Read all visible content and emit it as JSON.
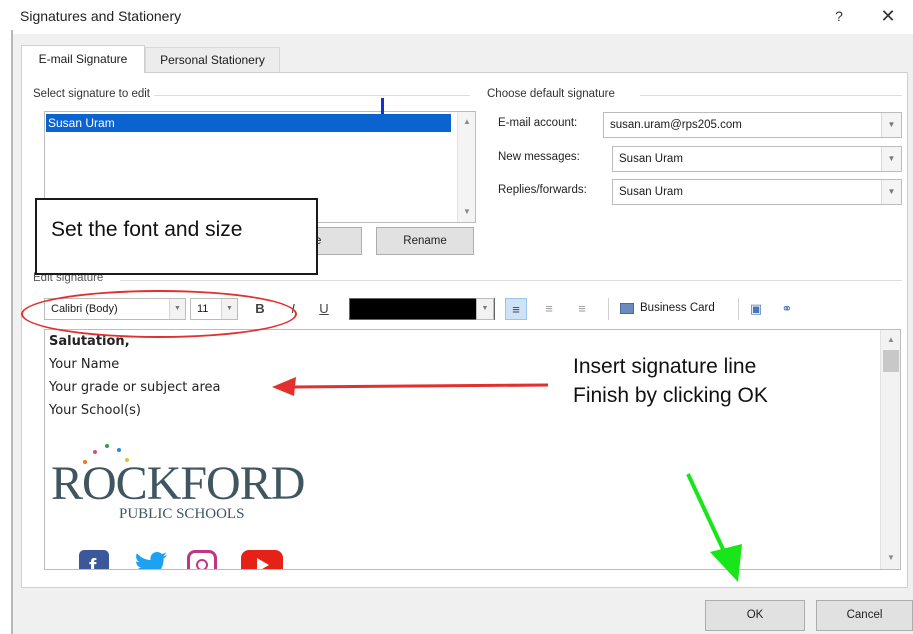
{
  "window": {
    "title": "Signatures and Stationery",
    "help_glyph": "?",
    "close_glyph": "✕"
  },
  "tabs": [
    {
      "label": "E-mail Signature",
      "active": true
    },
    {
      "label": "Personal Stationery",
      "active": false
    }
  ],
  "select_signature": {
    "label": "Select signature to edit",
    "items": [
      "Susan Uram"
    ],
    "selected": "Susan Uram",
    "buttons": {
      "save_partial": "e",
      "rename": "Rename"
    }
  },
  "default_signature": {
    "label": "Choose default signature",
    "email_account_label": "E-mail account:",
    "email_account_value": "susan.uram@rps205.com",
    "new_messages_label": "New messages:",
    "new_messages_value": "Susan Uram",
    "replies_label": "Replies/forwards:",
    "replies_value": "Susan Uram"
  },
  "edit_signature": {
    "label": "Edit signature",
    "font": "Calibri (Body)",
    "size": "11",
    "bold": "B",
    "italic": "I",
    "underline": "U",
    "font_color": "#000000",
    "business_card": "Business Card",
    "lines": [
      "Salutation,",
      "Your Name",
      "Your grade or subject area",
      "Your School(s)"
    ],
    "logo": {
      "word": "ROCKFORD",
      "sub": "PUBLIC SCHOOLS"
    },
    "social_icons": [
      "facebook-icon",
      "twitter-icon",
      "instagram-icon",
      "youtube-icon"
    ]
  },
  "annotations": {
    "callout": "Set the font and size",
    "instruction_line1": "Insert signature line",
    "instruction_line2": "Finish by clicking OK"
  },
  "footer": {
    "ok": "OK",
    "cancel": "Cancel"
  },
  "colors": {
    "selection": "#0a63cf",
    "dialog_bg": "#f0f0f0",
    "annot_red": "#e23030",
    "annot_green": "#19e619",
    "logo": "#3f5660"
  }
}
